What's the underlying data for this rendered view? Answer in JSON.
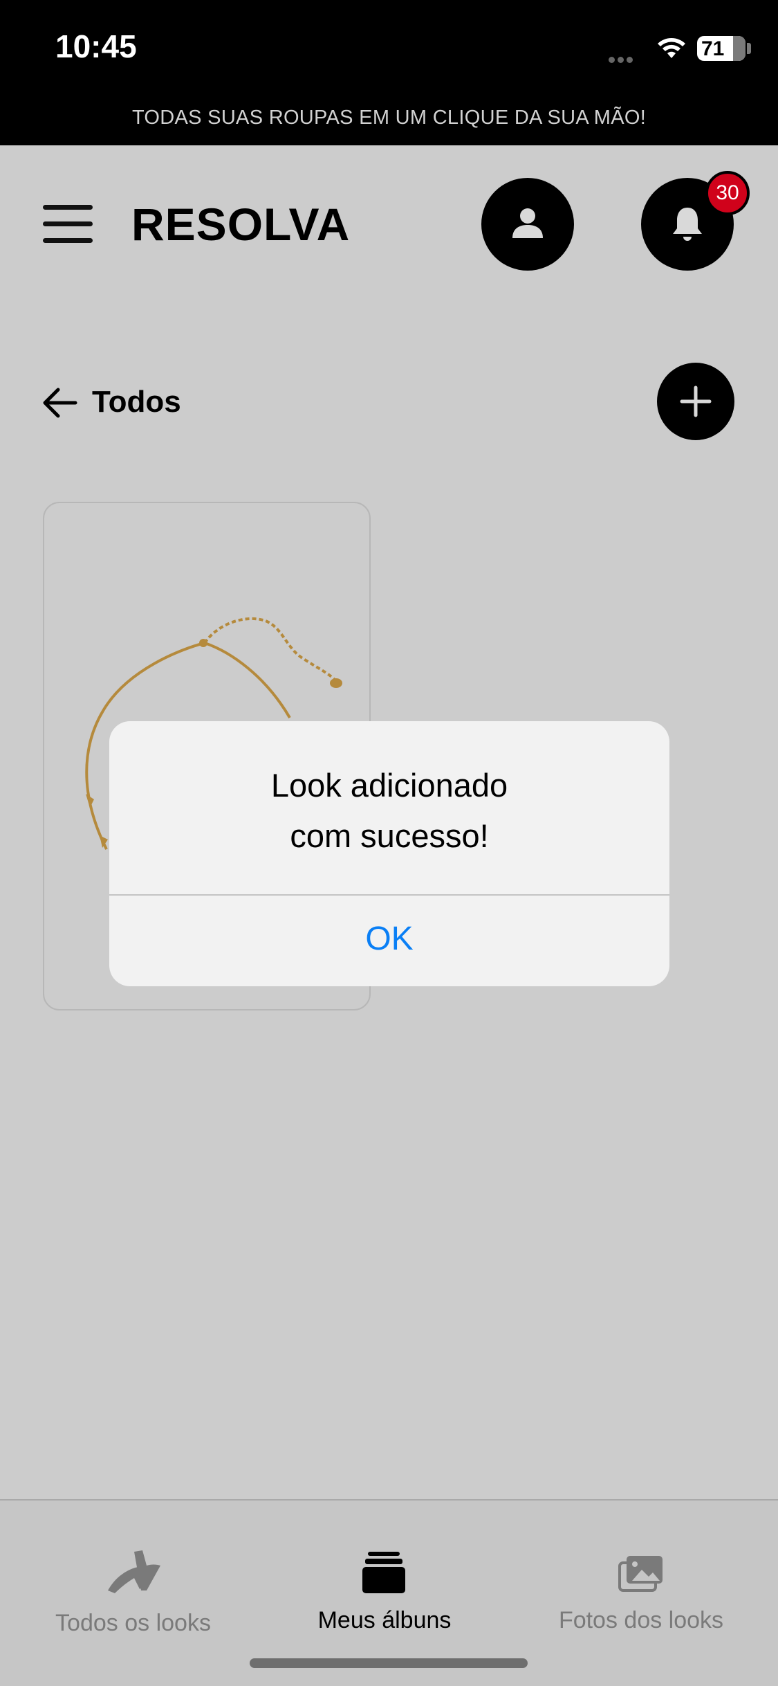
{
  "status_bar": {
    "time": "10:45",
    "battery": "71"
  },
  "promo_banner": "TODAS SUAS ROUPAS EM UM CLIQUE DA SUA MÃO!",
  "header": {
    "brand": "RESOLVA",
    "notification_count": "30"
  },
  "section": {
    "title": "Todos"
  },
  "dialog": {
    "message_line1": "Look adicionado",
    "message_line2": "com sucesso!",
    "ok_label": "OK",
    "ok_color": "#0a7ff5"
  },
  "tab_bar": {
    "tabs": [
      {
        "label": "Todos os looks",
        "icon": "heels-icon",
        "active": false
      },
      {
        "label": "Meus álbuns",
        "icon": "albums-stack-icon",
        "active": true
      },
      {
        "label": "Fotos dos looks",
        "icon": "photos-icon",
        "active": false
      }
    ]
  },
  "colors": {
    "badge": "#d0021b",
    "overlay_background": "#cccccc",
    "active_tab": "#000000",
    "inactive_tab": "#7a7a7a"
  }
}
